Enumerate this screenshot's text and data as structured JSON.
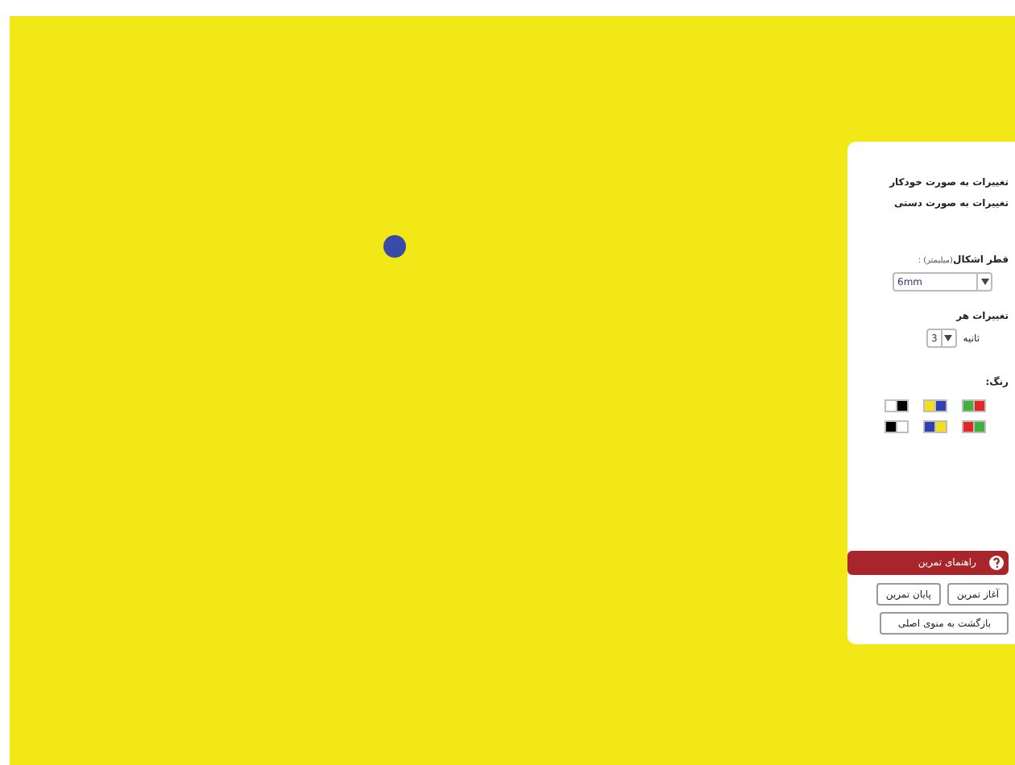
{
  "stage": {
    "dot": {
      "color": "#3a4aa8"
    }
  },
  "panel": {
    "modes": [
      {
        "label": "تغییرات به صورت خودکار"
      },
      {
        "label": "تغییرات به صورت دستی"
      }
    ],
    "size_label": "قطر اشکال",
    "size_unit": "(میلیمتر) :",
    "size_value": "6mm",
    "interval_label": "تغییرات هر",
    "interval_value": "3",
    "interval_unit": "ثانیه",
    "color_label": "رنگ:",
    "swatches": [
      {
        "colors": [
          {
            "color": "#ffffff"
          },
          {
            "color": "#000000"
          }
        ]
      },
      {
        "colors": [
          {
            "color": "#f0e020"
          },
          {
            "color": "#3040b0"
          }
        ]
      },
      {
        "colors": [
          {
            "color": "#40b040"
          },
          {
            "color": "#e02828"
          }
        ]
      },
      {
        "colors": [
          {
            "color": "#000000"
          },
          {
            "color": "#ffffff"
          }
        ]
      },
      {
        "colors": [
          {
            "color": "#3040b0"
          },
          {
            "color": "#f0e020"
          }
        ]
      },
      {
        "colors": [
          {
            "color": "#e02828"
          },
          {
            "color": "#40b040"
          }
        ]
      }
    ],
    "help_button": "راهنمای تمرین",
    "buttons": [
      "آغاز تمرین",
      "پایان تمرین"
    ],
    "back_button": "بازگشت به منوی اصلی"
  }
}
